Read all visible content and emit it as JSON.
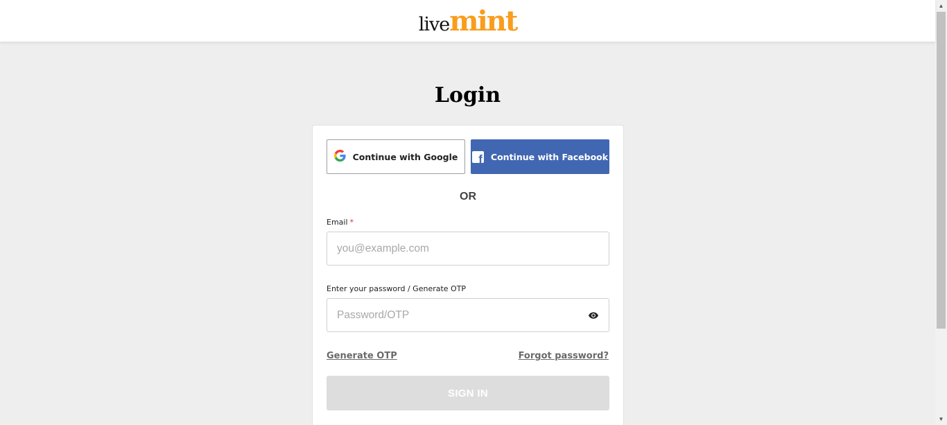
{
  "header": {
    "logo_live": "live",
    "logo_mint": "mint"
  },
  "page": {
    "title": "Login"
  },
  "social": {
    "google_label": "Continue with Google",
    "facebook_label": "Continue with Facebook",
    "facebook_icon_letter": "f"
  },
  "divider": {
    "or_text": "OR"
  },
  "form": {
    "email_label": "Email",
    "email_required_mark": "*",
    "email_value": "",
    "email_placeholder": "you@example.com",
    "password_label": "Enter your password / Generate OTP",
    "password_value": "",
    "password_placeholder": "Password/OTP",
    "generate_otp_label": "Generate OTP",
    "forgot_password_label": "Forgot password?",
    "signin_label": "SIGN IN"
  },
  "icons": {
    "google": "google-g-icon",
    "facebook": "facebook-icon",
    "password_toggle": "eye-icon"
  },
  "colors": {
    "brand_orange": "#f99d1c",
    "facebook_blue": "#4267b2",
    "page_background": "#eeeeee",
    "signin_disabled": "#dddddd"
  }
}
